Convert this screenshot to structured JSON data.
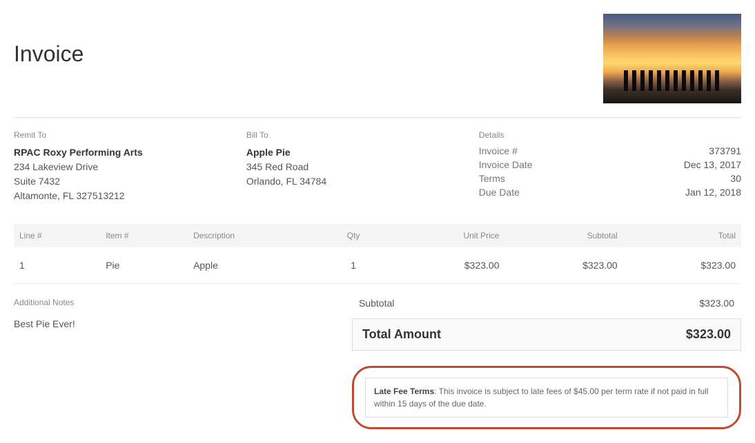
{
  "title": "Invoice",
  "remit": {
    "label": "Remit To",
    "name": "RPAC Roxy Performing Arts",
    "line1": "234 Lakeview Drive",
    "line2": "Suite 7432",
    "line3": "Altamonte, FL 327513212"
  },
  "bill": {
    "label": "Bill To",
    "name": "Apple Pie",
    "line1": "345 Red Road",
    "line2": "Orlando, FL 34784"
  },
  "details": {
    "label": "Details",
    "invoice_num_label": "Invoice #",
    "invoice_num": "373791",
    "invoice_date_label": "Invoice Date",
    "invoice_date": "Dec 13, 2017",
    "terms_label": "Terms",
    "terms": "30",
    "due_date_label": "Due Date",
    "due_date": "Jan 12, 2018"
  },
  "columns": {
    "line": "Line #",
    "item": "Item #",
    "desc": "Description",
    "qty": "Qty",
    "unit": "Unit Price",
    "subtotal": "Subtotal",
    "total": "Total"
  },
  "row": {
    "line": "1",
    "item": "Pie",
    "desc": "Apple",
    "qty": "1",
    "unit": "$323.00",
    "subtotal": "$323.00",
    "total": "$323.00"
  },
  "notes": {
    "label": "Additional Notes",
    "body": "Best Pie Ever!"
  },
  "totals": {
    "subtotal_label": "Subtotal",
    "subtotal": "$323.00",
    "total_label": "Total Amount",
    "total": "$323.00"
  },
  "latefee": {
    "label": "Late Fee Terms",
    "text": ": This invoice is subject to late fees of $45.00 per term rate if not paid in full within 15 days of the due date."
  }
}
